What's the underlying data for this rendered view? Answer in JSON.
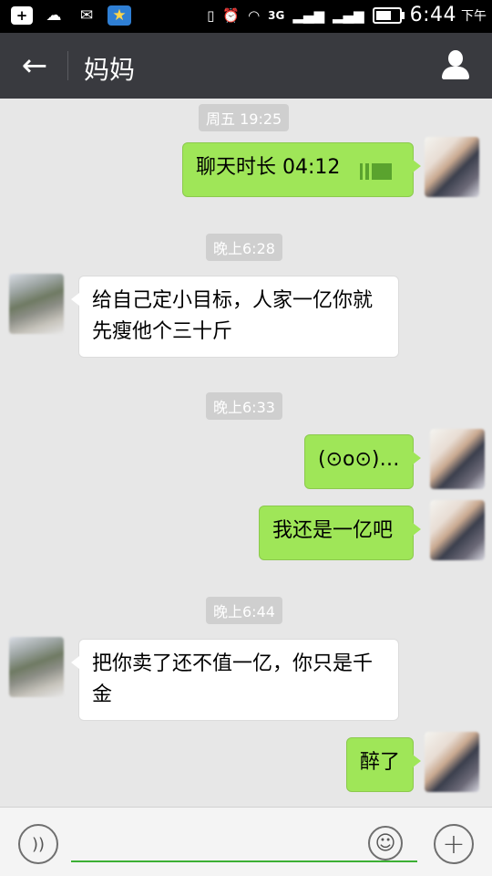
{
  "status_bar": {
    "time": "6:44",
    "ampm": "下午",
    "network_label": "3G"
  },
  "title_bar": {
    "back_icon": "←",
    "title": "妈妈",
    "profile_icon": "person-icon"
  },
  "messages": [
    {
      "type": "timestamp",
      "text": "周五 19:25"
    },
    {
      "type": "out",
      "text": "聊天时长 04:12",
      "icon": "voice-call-icon"
    },
    {
      "type": "timestamp",
      "text": "晚上6:28"
    },
    {
      "type": "in",
      "text": "给自己定小目标，人家一亿你就先瘦他个三十斤"
    },
    {
      "type": "timestamp",
      "text": "晚上6:33"
    },
    {
      "type": "out",
      "text": "(⊙o⊙)…"
    },
    {
      "type": "out",
      "text": "我还是一亿吧"
    },
    {
      "type": "timestamp",
      "text": "晚上6:44"
    },
    {
      "type": "in",
      "text": "把你卖了还不值一亿，你只是千金"
    },
    {
      "type": "out",
      "text": "醉了"
    }
  ],
  "input_bar": {
    "voice_icon": "voice-toggle-icon",
    "emoji_icon": "emoji-icon",
    "plus_icon": "plus-icon"
  },
  "colors": {
    "title_bar_bg": "#393a3f",
    "out_bubble": "#9fe658",
    "in_bubble": "#ffffff",
    "chat_bg": "#e7e7e7",
    "input_underline": "#3cb034"
  }
}
